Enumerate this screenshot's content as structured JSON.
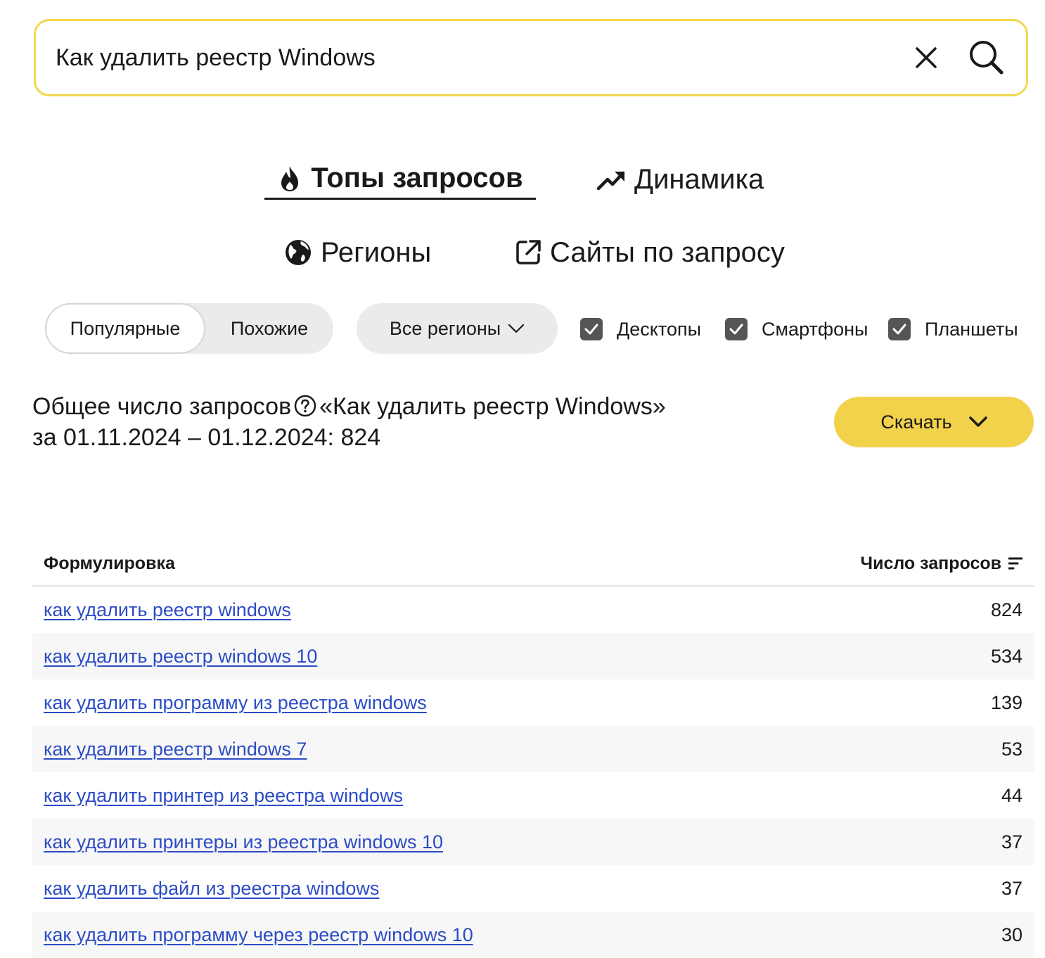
{
  "search": {
    "value": "Как удалить реестр Windows",
    "clear_icon": "close-icon",
    "submit_icon": "search-icon"
  },
  "tabs": [
    {
      "label": "Топы запросов",
      "icon": "fire-icon",
      "active": true
    },
    {
      "label": "Динамика",
      "icon": "trending-up-icon",
      "active": false
    },
    {
      "label": "Регионы",
      "icon": "globe-icon",
      "active": false
    },
    {
      "label": "Сайты по запросу",
      "icon": "external-link-icon",
      "active": false
    }
  ],
  "filters": {
    "mode_segments": [
      {
        "label": "Популярные",
        "active": true
      },
      {
        "label": "Похожие",
        "active": false
      }
    ],
    "region": "Все регионы",
    "devices": [
      {
        "label": "Десктопы",
        "checked": true
      },
      {
        "label": "Смартфоны",
        "checked": true
      },
      {
        "label": "Планшеты",
        "checked": true
      }
    ]
  },
  "summary": {
    "prefix": "Общее число запросов",
    "query": "«Как удалить реестр Windows»",
    "period": "за 01.11.2024 – 01.12.2024: 824"
  },
  "download": {
    "label": "Скачать"
  },
  "table": {
    "headers": {
      "phrase": "Формулировка",
      "count": "Число запросов"
    },
    "rows": [
      {
        "phrase": "как удалить реестр windows",
        "count": "824"
      },
      {
        "phrase": "как удалить реестр windows 10",
        "count": "534"
      },
      {
        "phrase": "как удалить программу из реестра windows",
        "count": "139"
      },
      {
        "phrase": "как удалить реестр windows 7",
        "count": "53"
      },
      {
        "phrase": "как удалить принтер из реестра windows",
        "count": "44"
      },
      {
        "phrase": "как удалить принтеры из реестра windows 10",
        "count": "37"
      },
      {
        "phrase": "как удалить файл из реестра windows",
        "count": "37"
      },
      {
        "phrase": "как удалить программу через реестр windows 10",
        "count": "30"
      }
    ]
  },
  "colors": {
    "search_border": "#f2d84e",
    "download_bg": "#f2d24b",
    "link": "#2c4cc6",
    "checkbox": "#555555",
    "pill_bg": "#ebebeb",
    "row_stripe": "#f7f7f7"
  }
}
